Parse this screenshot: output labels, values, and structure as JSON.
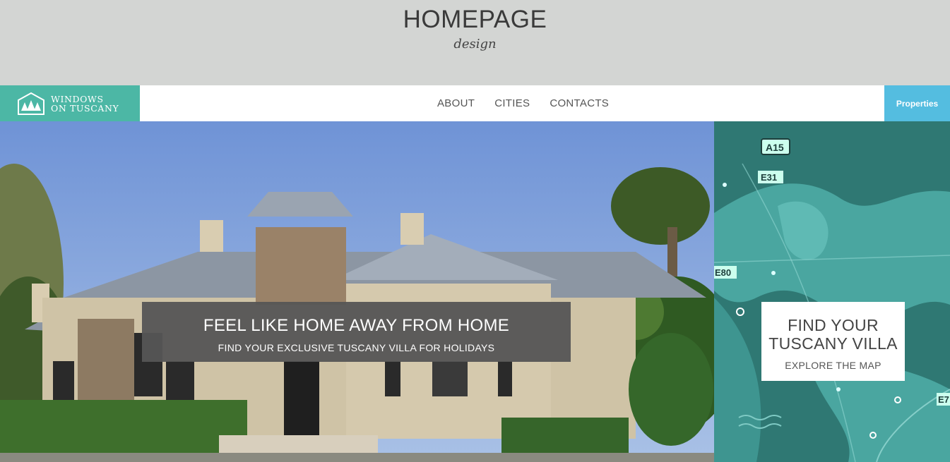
{
  "banner": {
    "title": "HOMEPAGE",
    "subtitle": "design"
  },
  "logo": {
    "line1": "WINDOWS",
    "line2": "ON TUSCANY",
    "icon": "tree-logo-icon"
  },
  "nav": {
    "items": [
      {
        "label": "ABOUT"
      },
      {
        "label": "CITIES"
      },
      {
        "label": "CONTACTS"
      }
    ]
  },
  "properties_button": {
    "label": "Properties"
  },
  "hero": {
    "title": "FEEL LIKE HOME AWAY FROM HOME",
    "subtitle": "FIND YOUR EXCLUSIVE TUSCANY VILLA FOR HOLIDAYS"
  },
  "map": {
    "card_title_line1": "FIND YOUR",
    "card_title_line2": "TUSCANY VILLA",
    "card_link": "EXPLORE THE MAP",
    "road_labels": [
      "A15",
      "E31",
      "E80",
      "E7"
    ]
  },
  "colors": {
    "accent": "#4cb7a5",
    "properties": "#54bde0",
    "banner_bg": "#d3d5d3",
    "overlay": "#555555"
  }
}
